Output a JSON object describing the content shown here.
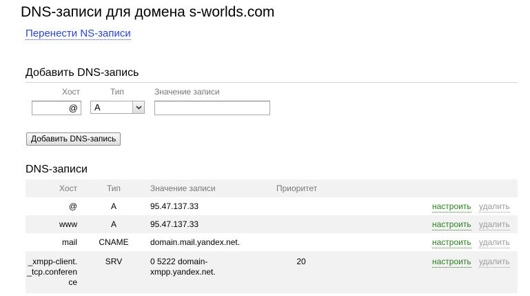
{
  "page": {
    "title": "DNS-записи для домена s-worlds.com",
    "ns_link": "Перенести NS-записи"
  },
  "add_form": {
    "title": "Добавить DNS-запись",
    "host_label": "Хост",
    "type_label": "Тип",
    "value_label": "Значение записи",
    "host_value": "@",
    "type_value": "A",
    "value_value": "",
    "submit_label": "Добавить DNS-запись"
  },
  "records": {
    "title": "DNS-записи",
    "columns": [
      "Хост",
      "Тип",
      "Значение записи",
      "Приоритет"
    ],
    "rows": [
      {
        "host": "@",
        "type": "A",
        "value": "95.47.137.33",
        "priority": "",
        "edit": "настроить",
        "delete": "удалить"
      },
      {
        "host": "www",
        "type": "A",
        "value": "95.47.137.33",
        "priority": "",
        "edit": "настроить",
        "delete": "удалить"
      },
      {
        "host": "mail",
        "type": "CNAME",
        "value": "domain.mail.yandex.net.",
        "priority": "",
        "edit": "настроить",
        "delete": "удалить"
      },
      {
        "host": "_xmpp-client._tcp.conference",
        "type": "SRV",
        "value": "0 5222 domain-xmpp.yandex.net.",
        "priority": "20",
        "edit": "настроить",
        "delete": "удалить"
      }
    ]
  },
  "icons": {
    "select_arrow": "chevron-down-icon"
  },
  "colors": {
    "link": "#2b45c2",
    "edit_link": "#2a7d1f",
    "delete_link": "#9a9a9a",
    "row_shade": "#f2f2f2",
    "header_shade": "#f2f2f2"
  }
}
